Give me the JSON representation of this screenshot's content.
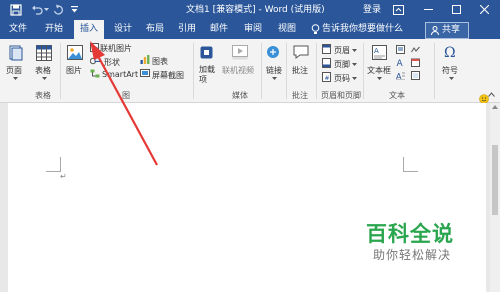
{
  "window": {
    "title": "文档1 [兼容模式] - Word (试用版)",
    "login": "登录"
  },
  "tabs": [
    "文件",
    "开始",
    "插入",
    "设计",
    "布局",
    "引用",
    "邮件",
    "审阅",
    "视图"
  ],
  "active_tab": "插入",
  "tell_me": "告诉我你想要做什么",
  "share": "共享",
  "ribbon": {
    "pages": "页面",
    "table": "表格",
    "picture": "图片",
    "online_picture": "联机图片",
    "shapes": "形状",
    "smartart": "SmartArt",
    "chart": "图表",
    "screenshot": "屏幕截图",
    "illustrations_short": "图",
    "addins": "加载项",
    "online_video": "联机视频",
    "link": "链接",
    "comment": "批注",
    "header": "页眉",
    "footer": "页脚",
    "page_number": "页码",
    "textbox": "文本框",
    "symbol": "符号",
    "groups": {
      "table": "表格",
      "media": "媒体",
      "comment": "批注",
      "header_footer": "页眉和页脚",
      "text": "文本"
    }
  },
  "watermark": {
    "title": "百科全说",
    "subtitle": "助你轻松解决"
  },
  "colors": {
    "accent": "#2b579a",
    "annotation": "#e53935",
    "watermark": "#2aa64f"
  }
}
